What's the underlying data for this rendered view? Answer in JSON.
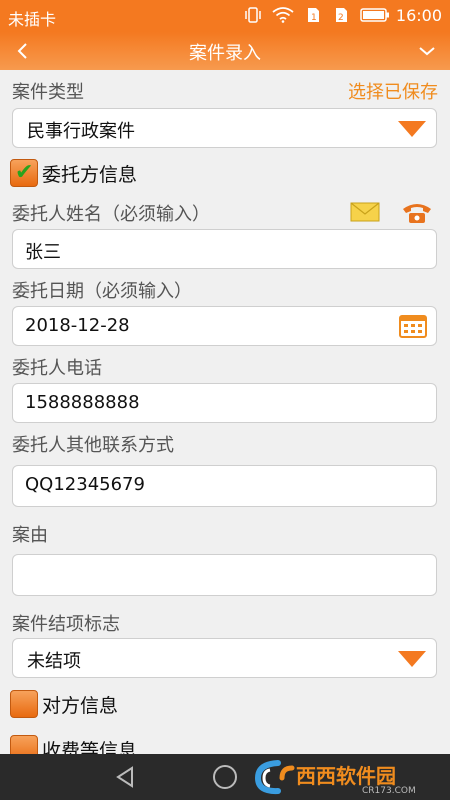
{
  "status_bar": {
    "carrier": "未插卡",
    "time": "16:00",
    "icons": [
      "vibrate-icon",
      "wifi-icon",
      "sim1-icon",
      "sim2-icon",
      "battery-icon"
    ]
  },
  "title_bar": {
    "back_icon": "chevron-left-icon",
    "title": "案件录入",
    "menu_icon": "chevron-down-icon"
  },
  "form": {
    "case_type_label": "案件类型",
    "select_saved_label": "选择已保存",
    "case_type_value": "民事行政案件",
    "client_info_label": "委托方信息",
    "client_info_checked": true,
    "client_name_label": "委托人姓名（必须输入）",
    "client_name_value": "张三",
    "client_date_label": "委托日期（必须输入）",
    "client_date_value": "2018-12-28",
    "client_phone_label": "委托人电话",
    "client_phone_value": "1588888888",
    "client_other_contact_label": "委托人其他联系方式",
    "client_other_contact_value": "QQ12345679",
    "case_reason_label": "案由",
    "case_reason_value": "",
    "case_close_flag_label": "案件结项标志",
    "case_close_flag_value": "未结项",
    "opposite_info_label": "对方信息",
    "opposite_info_checked": true,
    "fee_info_label": "收费等信息",
    "fee_info_checked": true
  },
  "colors": {
    "accent": "#f47920",
    "link": "#f08c1e",
    "check": "#2aa31d",
    "nav_bg": "#2a2a2a"
  },
  "watermark": {
    "brand": "西西软件园",
    "domain": "CR173.COM"
  }
}
